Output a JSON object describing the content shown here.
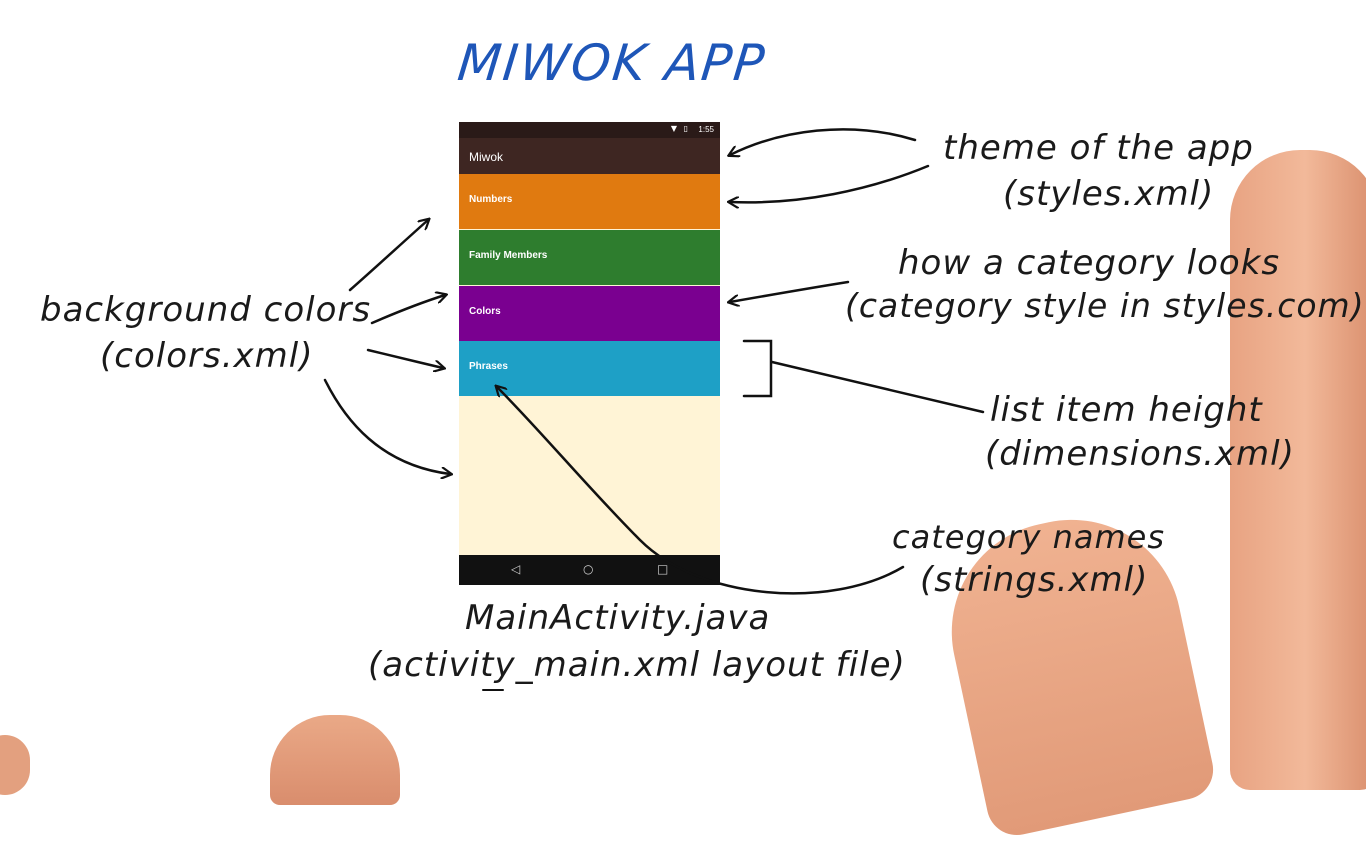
{
  "title": "MIWOK APP",
  "phone": {
    "status_time": "1:55",
    "status_icons": "▼ ▯",
    "app_title": "Miwok",
    "categories": [
      {
        "label": "Numbers",
        "color": "#e07a10"
      },
      {
        "label": "Family Members",
        "color": "#2e7d2e"
      },
      {
        "label": "Colors",
        "color": "#7a0090"
      },
      {
        "label": "Phrases",
        "color": "#1ea0c6"
      }
    ],
    "background_color": "#fff4d6",
    "nav": {
      "back": "◁",
      "home": "○",
      "recent": "□"
    }
  },
  "annotations": {
    "background_colors": {
      "line1": "background colors",
      "line2": "(colors.xml)"
    },
    "theme": {
      "line1": "theme of the app",
      "line2": "(styles.xml)"
    },
    "category_style": {
      "line1": "how a category looks",
      "line2": "(category style in styles.com)"
    },
    "item_height": {
      "line1": "list item height",
      "line2": "(dimensions.xml)"
    },
    "category_names": {
      "line1": "category names",
      "line2": "(strings.xml)"
    },
    "main_activity": {
      "line1": "MainActivity.java",
      "line2": "(activity_main.xml layout file)"
    }
  }
}
